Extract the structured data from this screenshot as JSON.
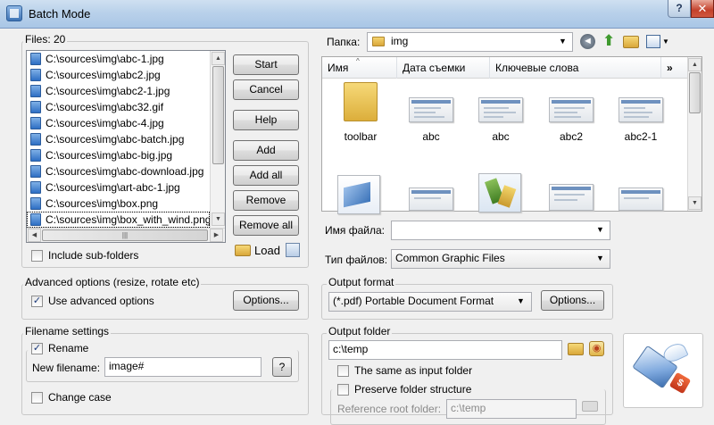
{
  "window": {
    "title": "Batch Mode",
    "help_label": "?",
    "close_label": "✕"
  },
  "files": {
    "label": "Files: 20",
    "items": [
      "C:\\sources\\img\\abc-1.jpg",
      "C:\\sources\\img\\abc2.jpg",
      "C:\\sources\\img\\abc2-1.jpg",
      "C:\\sources\\img\\abc32.gif",
      "C:\\sources\\img\\abc-4.jpg",
      "C:\\sources\\img\\abc-batch.jpg",
      "C:\\sources\\img\\abc-big.jpg",
      "C:\\sources\\img\\abc-download.jpg",
      "C:\\sources\\img\\art-abc-1.jpg",
      "C:\\sources\\img\\box.png",
      "C:\\sources\\img\\box_with_wind.png"
    ],
    "hscroll_grip": "|||",
    "include_subfolders": "Include sub-folders",
    "include_subfolders_checked": false
  },
  "buttons": {
    "start": "Start",
    "cancel": "Cancel",
    "help": "Help",
    "add": "Add",
    "add_all": "Add all",
    "remove": "Remove",
    "remove_all": "Remove all",
    "load": "Load"
  },
  "browser": {
    "folder_label": "Папка:",
    "folder_value": "img",
    "columns": [
      "Имя",
      "Дата съемки",
      "Ключевые слова"
    ],
    "more": "»",
    "thumbs_row1": [
      "toolbar",
      "abc",
      "abc",
      "abc2",
      "abc2-1"
    ],
    "filename_label": "Имя файла:",
    "filename_value": "",
    "filetype_label": "Тип файлов:",
    "filetype_value": "Common Graphic Files"
  },
  "advanced": {
    "group_label": "Advanced options (resize, rotate etc)",
    "use_label": "Use advanced options",
    "use_checked": true,
    "options_button": "Options..."
  },
  "output_format": {
    "group_label": "Output format",
    "value": "(*.pdf) Portable Document Format",
    "options_button": "Options..."
  },
  "filename_settings": {
    "group_label": "Filename settings",
    "rename_label": "Rename",
    "rename_checked": true,
    "new_filename_label": "New filename:",
    "new_filename_value": "image#",
    "help_button": "?",
    "change_case_label": "Change case",
    "change_case_checked": false
  },
  "output_folder": {
    "group_label": "Output folder",
    "value": "c:\\temp",
    "same_as_input": "The same as input folder",
    "same_checked": false,
    "preserve": "Preserve folder structure",
    "preserve_checked": false,
    "reference_label": "Reference root folder:",
    "reference_value": "c:\\temp"
  },
  "colors": {
    "accent": "#3b73b9",
    "titlebar": "#b9d1ea",
    "close": "#c4412b"
  }
}
